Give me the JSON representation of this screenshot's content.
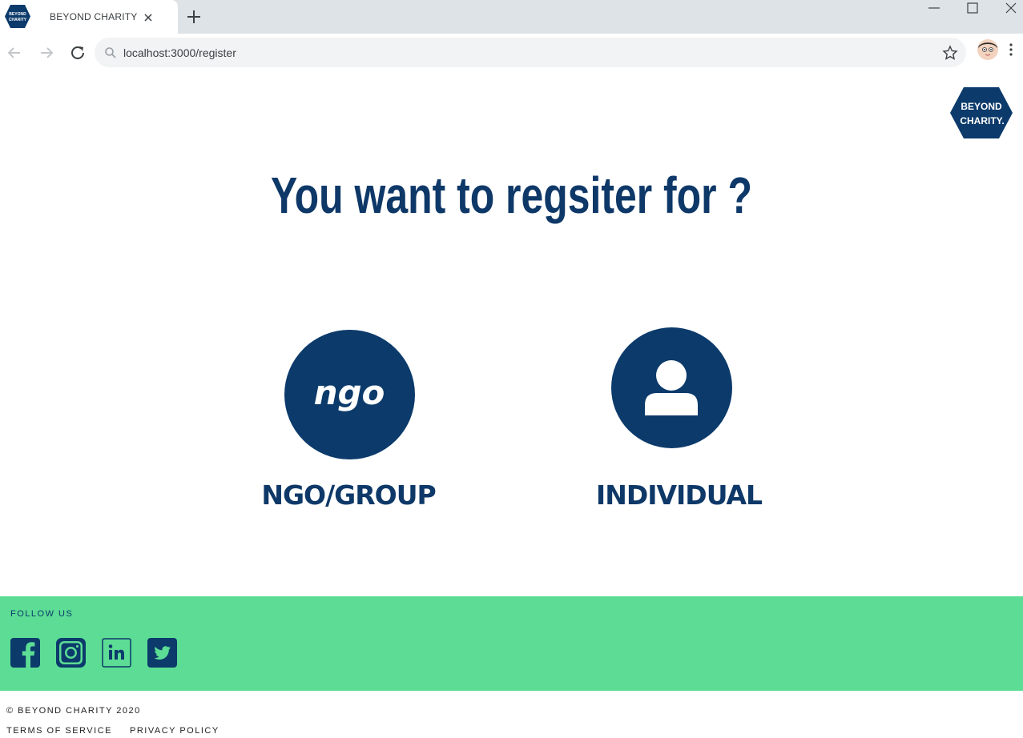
{
  "browser": {
    "tab_title": "BEYOND CHARITY",
    "favicon_text_line1": "BEYOND",
    "favicon_text_line2": "CHARITY",
    "url": "localhost:3000/register"
  },
  "brand": {
    "logo_line1": "BEYOND",
    "logo_line2": "CHARITY."
  },
  "main": {
    "title": "You want to regsiter for ?",
    "options": [
      {
        "label": "NGO/GROUP",
        "icon": "ngo-icon",
        "icon_text": "ngo"
      },
      {
        "label": "INDIVIDUAL",
        "icon": "person-icon"
      }
    ]
  },
  "footer": {
    "follow_label": "FOLLOW US",
    "social": [
      "facebook-icon",
      "instagram-icon",
      "linkedin-icon",
      "twitter-icon"
    ],
    "copyright": "© BEYOND CHARITY 2020",
    "links": [
      "TERMS OF SERVICE",
      "PRIVACY POLICY"
    ]
  },
  "colors": {
    "brand_navy": "#0b3a6b",
    "footer_green": "#5cdc94"
  }
}
